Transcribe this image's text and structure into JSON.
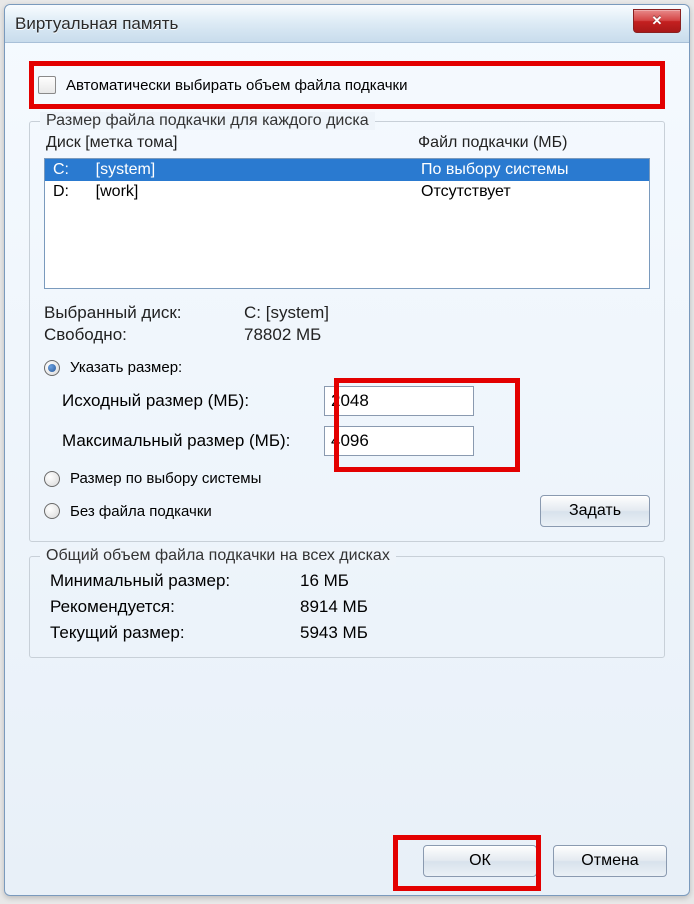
{
  "titlebar": {
    "title": "Виртуальная память",
    "close_icon": "✕"
  },
  "auto_checkbox": {
    "label": "Автоматически выбирать объем файла подкачки",
    "checked": false
  },
  "group_per_drive": {
    "title": "Размер файла подкачки для каждого диска",
    "header_drive": "Диск [метка тома]",
    "header_pagefile": "Файл подкачки (МБ)",
    "rows": [
      {
        "drive": "C:      [system]",
        "pagefile": "По выбору системы",
        "selected": true
      },
      {
        "drive": "D:      [work]",
        "pagefile": "Отсутствует",
        "selected": false
      }
    ],
    "selected_drive_label": "Выбранный диск:",
    "selected_drive_value": "C:  [system]",
    "free_label": "Свободно:",
    "free_value": "78802 МБ",
    "radio_custom": "Указать размер:",
    "initial_size_label": "Исходный размер (МБ):",
    "initial_size_value": "2048",
    "max_size_label": "Максимальный размер (МБ):",
    "max_size_value": "4096",
    "radio_system": "Размер по выбору системы",
    "radio_none": "Без файла подкачки",
    "set_button": "Задать"
  },
  "group_totals": {
    "title": "Общий объем файла подкачки на всех дисках",
    "min_label": "Минимальный размер:",
    "min_value": "16 МБ",
    "rec_label": "Рекомендуется:",
    "rec_value": "8914 МБ",
    "cur_label": "Текущий размер:",
    "cur_value": "5943 МБ"
  },
  "footer": {
    "ok": "ОК",
    "cancel": "Отмена"
  }
}
